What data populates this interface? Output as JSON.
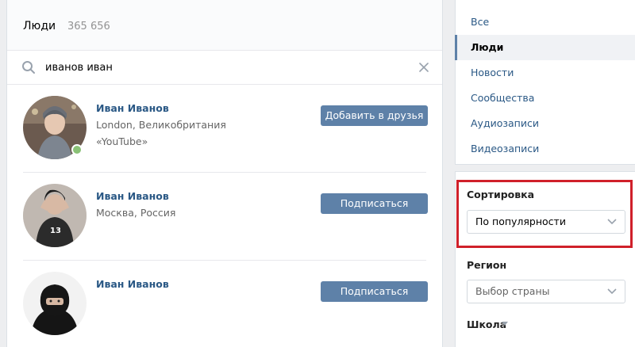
{
  "header": {
    "title": "Люди",
    "count": "365 656"
  },
  "search": {
    "value": "иванов иван"
  },
  "results": [
    {
      "name": "Иван Иванов",
      "line1": "London, Великобритания",
      "line2": "«YouTube»",
      "action": "Добавить в друзья",
      "online": true
    },
    {
      "name": "Иван Иванов",
      "line1": "Москва, Россия",
      "action": "Подписаться",
      "online": false
    },
    {
      "name": "Иван Иванов",
      "action": "Подписаться",
      "online": false
    }
  ],
  "nav": {
    "items": [
      "Все",
      "Люди",
      "Новости",
      "Сообщества",
      "Аудиозаписи",
      "Видеозаписи"
    ],
    "active": "Люди"
  },
  "filters": {
    "sort_label": "Сортировка",
    "sort_value": "По популярности",
    "region_label": "Регион",
    "region_value": "Выбор страны",
    "school_label": "Школа"
  },
  "colors": {
    "link": "#2a5885",
    "button": "#5e81a8",
    "online": "#8ac176",
    "highlight": "#d0202a"
  }
}
